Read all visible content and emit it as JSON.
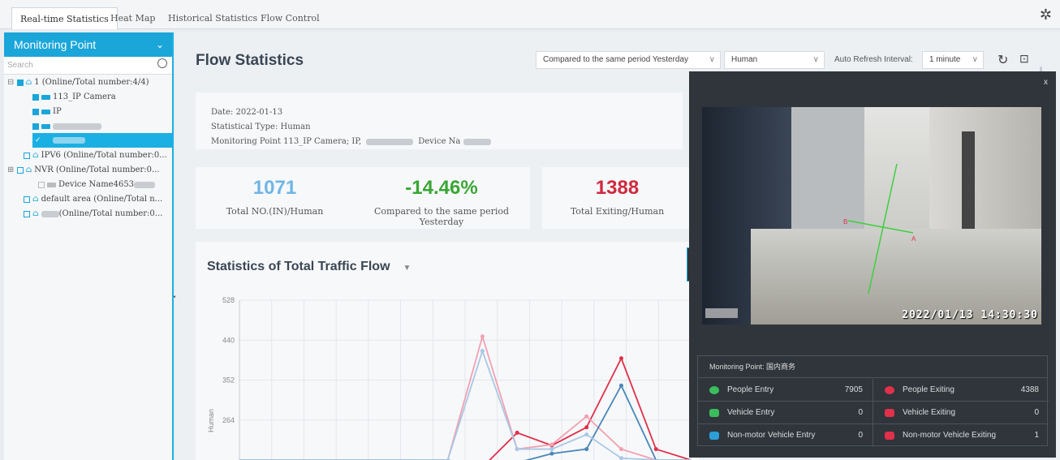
{
  "tabs": [
    "Real-time Statistics",
    "Heat Map",
    "Historical Statistics",
    "Flow Control"
  ],
  "sidebar": {
    "title": "Monitoring Point",
    "search_placeholder": "Search",
    "tree": [
      "1 (Online/Total number:4/4)",
      "113_IP Camera",
      "IP",
      "IPV6 (Online/Total number:0...",
      "NVR (Online/Total number:0...",
      "Device Name4653",
      "default area (Online/Total n...",
      "(Online/Total number:0..."
    ]
  },
  "main": {
    "title": "Flow Statistics",
    "compare_select": "Compared to the same period Yesterday",
    "type_select": "Human",
    "refresh_label": "Auto Refresh Interval:",
    "refresh_select": "1 minute",
    "info": {
      "date": "Date: 2022-01-13",
      "type": "Statistical Type: Human",
      "point": "Monitoring Point 113_IP Camera; IP,",
      "point_tail": "Device Na"
    },
    "cards": [
      {
        "value": "1071",
        "label": "Total NO.(IN)/Human",
        "color": "#6fb6e6"
      },
      {
        "value": "-14.46%",
        "label": "Compared to the same period Yesterday",
        "color": "#3aa635"
      },
      {
        "value": "1388",
        "label": "Total Exiting/Human",
        "color": "#cf2a3f"
      }
    ],
    "chart_title": "Statistics of Total Traffic Flow"
  },
  "chart_data": {
    "type": "line",
    "title": "Statistics of Total Traffic Flow",
    "ylabel": "Human",
    "ylim": [
      176,
      528
    ],
    "yticks": [
      528,
      440,
      352,
      264
    ],
    "x": [
      0,
      1,
      2,
      3,
      4,
      5,
      6,
      7
    ],
    "series": [
      {
        "color": "#e0304a",
        "values": [
          176,
          176,
          176,
          176,
          176,
          176,
          170,
          160,
          236,
          208,
          248,
          400,
          200,
          176
        ]
      },
      {
        "color": "#f2a0b0",
        "values": [
          176,
          176,
          176,
          176,
          176,
          176,
          176,
          448,
          200,
          210,
          272,
          200,
          176,
          176
        ]
      },
      {
        "color": "#4a86b8",
        "values": [
          176,
          176,
          176,
          176,
          176,
          176,
          176,
          160,
          170,
          190,
          200,
          340,
          176,
          176
        ]
      },
      {
        "color": "#a9c8e4",
        "values": [
          176,
          176,
          176,
          176,
          176,
          176,
          176,
          416,
          200,
          200,
          232,
          180,
          176,
          176
        ]
      }
    ]
  },
  "popup": {
    "close": "x",
    "timestamp": "2022/01/13 14:30:30",
    "monitoring_point": "Monitoring Point: 国内商务",
    "rows": [
      {
        "label": "People Entry",
        "value": "7905",
        "color": "#3bbd5c"
      },
      {
        "label": "People Exiting",
        "value": "4388",
        "color": "#e0304a"
      },
      {
        "label": "Vehicle Entry",
        "value": "0",
        "color": "#3bbd5c"
      },
      {
        "label": "Vehicle Exiting",
        "value": "0",
        "color": "#e0304a"
      },
      {
        "label": "Non-motor Vehicle Entry",
        "value": "0",
        "color": "#2c9fd6"
      },
      {
        "label": "Non-motor Vehicle Exiting",
        "value": "1",
        "color": "#e0304a"
      }
    ]
  }
}
